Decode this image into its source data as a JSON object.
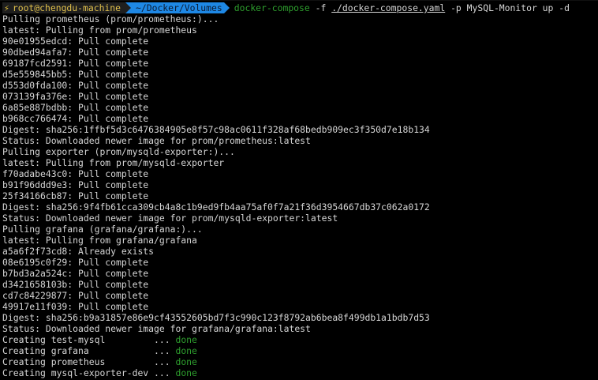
{
  "colors": {
    "background": "#000000",
    "text": "#d6d6d6",
    "prompt_user_bg": "#1f1f1f",
    "prompt_user_fg": "#e8c53a",
    "prompt_path_bg": "#1e88e5",
    "command_green": "#2e9f2e",
    "done_green": "#2e9f2e"
  },
  "prompt": {
    "bolt_icon": "⚡",
    "user_host": "root@chengdu-machine",
    "path": "~/Docker/Volumes",
    "command": "docker-compose",
    "flag_f": "-f",
    "compose_file": "./docker-compose.yaml",
    "args": "-p MySQL-Monitor up -d"
  },
  "output": [
    "Pulling prometheus (prom/prometheus:)...",
    "latest: Pulling from prom/prometheus",
    "90e01955edcd: Pull complete",
    "90dbed94afa7: Pull complete",
    "69187fcd2591: Pull complete",
    "d5e559845bb5: Pull complete",
    "d553d0fda100: Pull complete",
    "073139fa376e: Pull complete",
    "6a85e887bdbb: Pull complete",
    "b968cc766474: Pull complete",
    "Digest: sha256:1ffbf5d3c6476384905e8f57c98ac0611f328af68bedb909ec3f350d7e18b134",
    "Status: Downloaded newer image for prom/prometheus:latest",
    "Pulling exporter (prom/mysqld-exporter:)...",
    "latest: Pulling from prom/mysqld-exporter",
    "f70adabe43c0: Pull complete",
    "b91f96ddd9e3: Pull complete",
    "25f34166cb87: Pull complete",
    "Digest: sha256:9f4fb61cca309cb4a8c1b9ed9fb4aa75af0f7a21f36d3954667db37c062a0172",
    "Status: Downloaded newer image for prom/mysqld-exporter:latest",
    "Pulling grafana (grafana/grafana:)...",
    "latest: Pulling from grafana/grafana",
    "a5a6f2f73cd8: Already exists",
    "08e6195c0f29: Pull complete",
    "b7bd3a2a524c: Pull complete",
    "d3421658103b: Pull complete",
    "cd7c84229877: Pull complete",
    "49917e11f039: Pull complete",
    "Digest: sha256:b9a31857e86e9cf43552605bd7f3c990c123f8792ab6bea8f499db1a1bdb7d53",
    "Status: Downloaded newer image for grafana/grafana:latest"
  ],
  "creating": [
    {
      "label": "Creating test-mysql        ",
      "dots": " ... ",
      "status": "done"
    },
    {
      "label": "Creating grafana           ",
      "dots": " ... ",
      "status": "done"
    },
    {
      "label": "Creating prometheus        ",
      "dots": " ... ",
      "status": "done"
    },
    {
      "label": "Creating mysql-exporter-dev",
      "dots": " ... ",
      "status": "done"
    }
  ]
}
